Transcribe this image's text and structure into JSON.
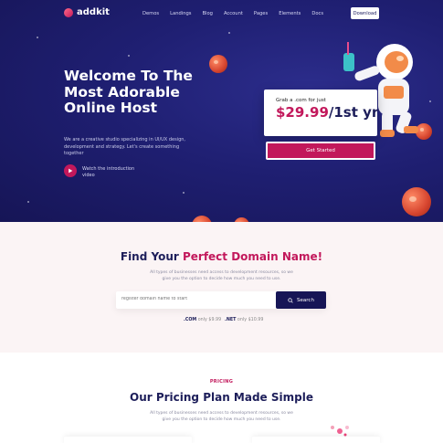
{
  "brand": {
    "name": "addkit"
  },
  "nav": {
    "items": [
      "Demos",
      "Landings",
      "Blog",
      "Account",
      "Pages",
      "Elements",
      "Docs"
    ],
    "download_label": "Download"
  },
  "hero": {
    "title": "Welcome To The Most Adorable Online Host",
    "subtitle": "We are a creative studio specializing in UI/UX design, development and strategy. Let's create something together",
    "watch_label": "Watch the introduction video"
  },
  "offer": {
    "top_text": "Grab a .com for just",
    "price": "$29.99",
    "period": "/1st yr",
    "cta": "Get Started"
  },
  "domain": {
    "title_prefix": "Find Your ",
    "title_highlight": "Perfect Domain Name!",
    "description": "All types of businesses need access to development resources, so we give you the option to decide how much you need to use.",
    "search_placeholder": "register domain name to start",
    "search_button": "Search",
    "tlds": [
      {
        "ext": ".COM",
        "price": "only $9.99"
      },
      {
        "ext": ".NET",
        "price": "only $10.99"
      }
    ]
  },
  "pricing": {
    "tag": "PRICING",
    "title": "Our Pricing Plan Made Simple",
    "description": "All types of businesses need access to development resources, so we give you the option to decide how much you need to use."
  },
  "colors": {
    "accent": "#c2185b",
    "navy": "#161556",
    "hero_bg": "#1f1f72"
  }
}
